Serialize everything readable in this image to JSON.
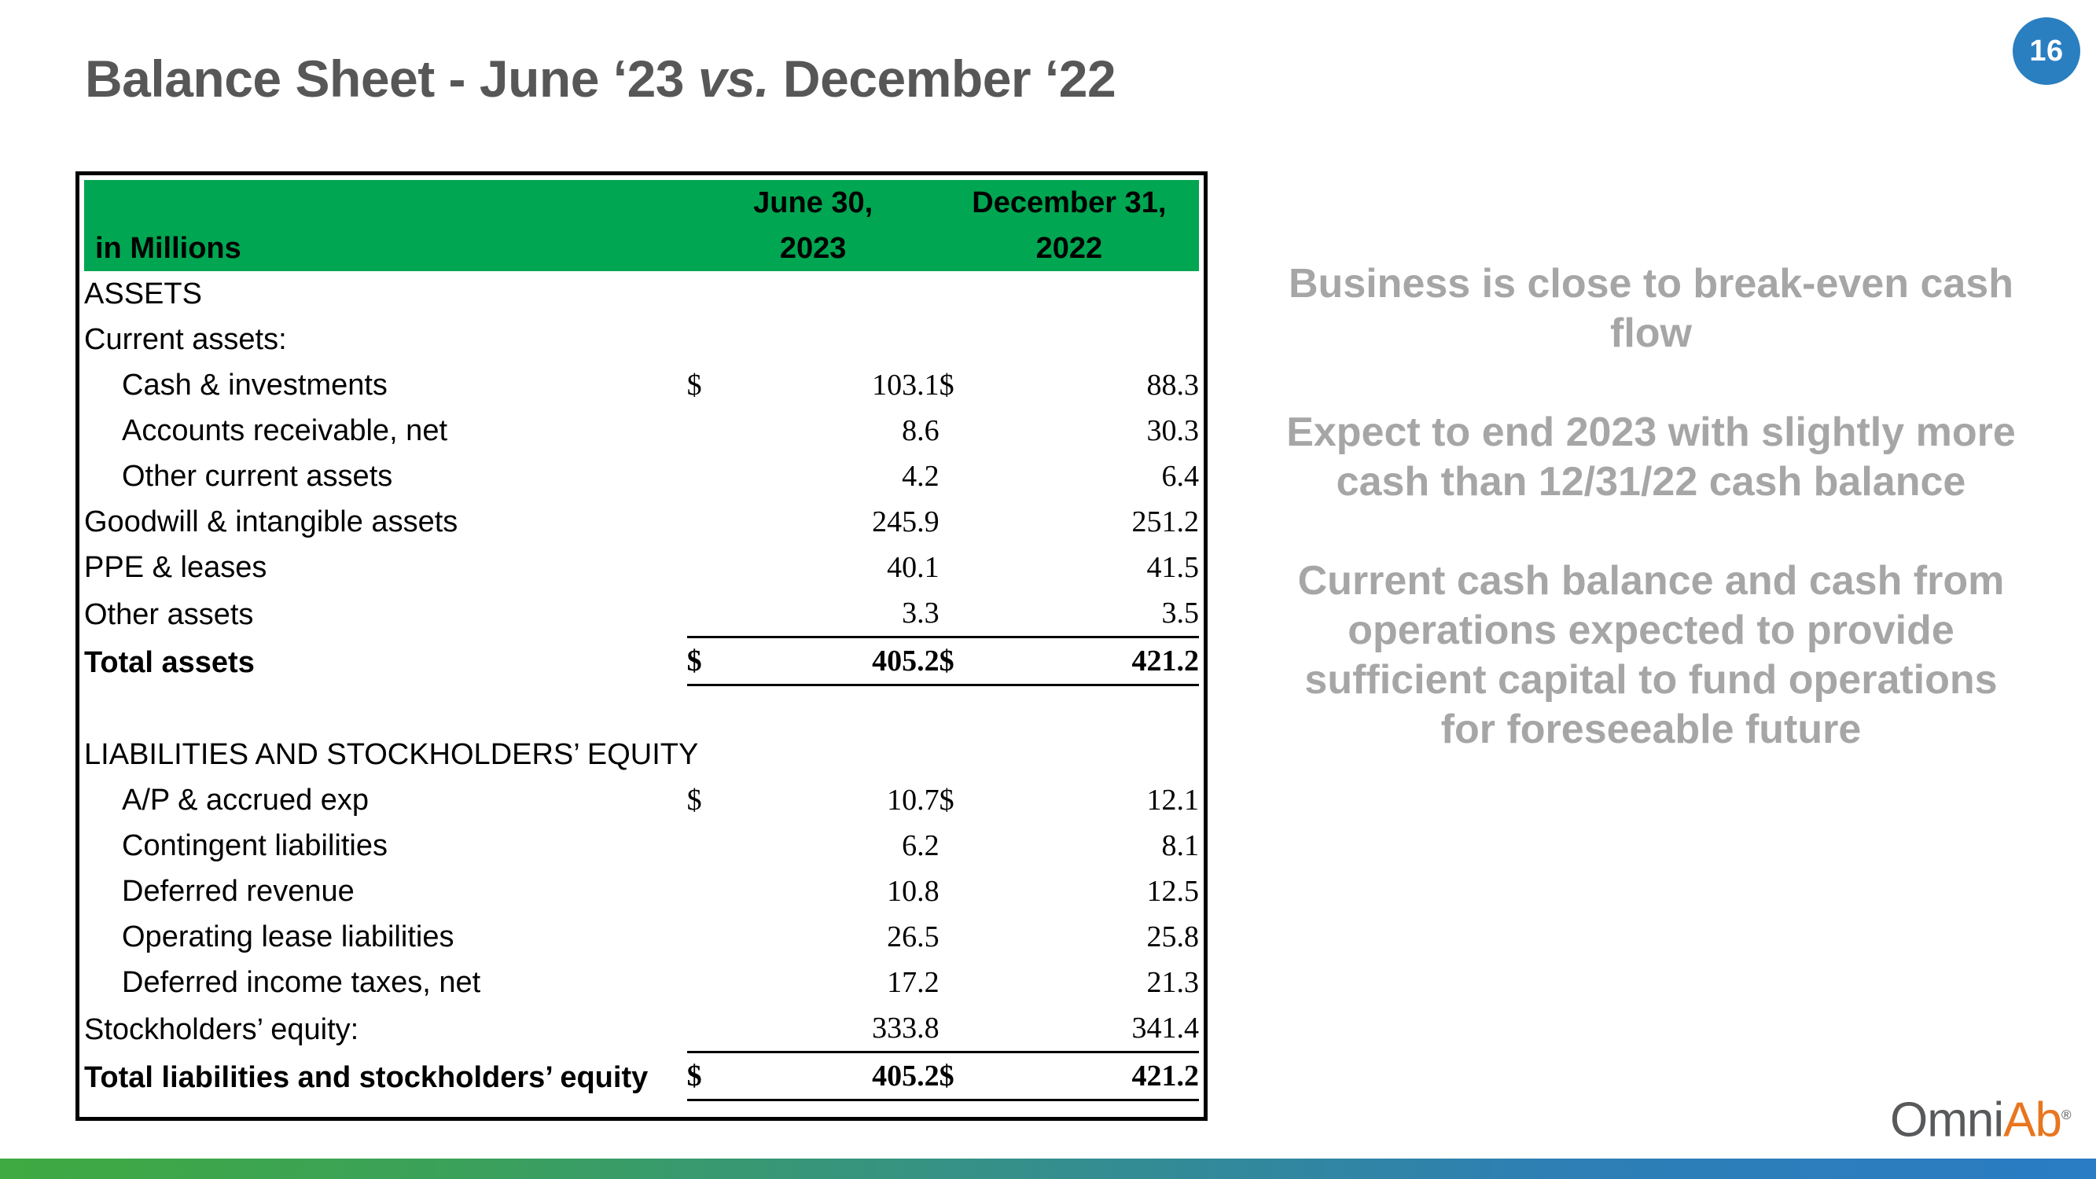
{
  "page_number": "16",
  "title": {
    "before": "Balance Sheet - June ‘23 ",
    "vs": "vs.",
    "after": " December ‘22"
  },
  "table": {
    "header": {
      "label": "in Millions",
      "col1_line1": "June 30,",
      "col1_line2": "2023",
      "col2_line1": "December 31,",
      "col2_line2": "2022"
    },
    "rows": [
      {
        "label": "ASSETS",
        "indent": false,
        "bold": false,
        "cur1": "",
        "val1": "",
        "cur2": "",
        "val2": ""
      },
      {
        "label": "Current assets:",
        "indent": false,
        "bold": false,
        "cur1": "",
        "val1": "",
        "cur2": "",
        "val2": ""
      },
      {
        "label": "Cash & investments",
        "indent": true,
        "bold": false,
        "cur1": "$",
        "val1": "103.1",
        "cur2": "$",
        "val2": "88.3"
      },
      {
        "label": "Accounts receivable, net",
        "indent": true,
        "bold": false,
        "cur1": "",
        "val1": "8.6",
        "cur2": "",
        "val2": "30.3"
      },
      {
        "label": "Other current assets",
        "indent": true,
        "bold": false,
        "cur1": "",
        "val1": "4.2",
        "cur2": "",
        "val2": "6.4"
      },
      {
        "label": "Goodwill & intangible assets",
        "indent": false,
        "bold": false,
        "cur1": "",
        "val1": "245.9",
        "cur2": "",
        "val2": "251.2"
      },
      {
        "label": "PPE & leases",
        "indent": false,
        "bold": false,
        "cur1": "",
        "val1": "40.1",
        "cur2": "",
        "val2": "41.5"
      },
      {
        "label": "Other assets",
        "indent": false,
        "bold": false,
        "cur1": "",
        "val1": "3.3",
        "cur2": "",
        "val2": "3.5"
      },
      {
        "label": "Total assets",
        "indent": false,
        "bold": true,
        "cur1": "$",
        "val1": "405.2",
        "cur2": "$",
        "val2": "421.2",
        "rule_top": true,
        "rule_bottom": true
      },
      {
        "label": "",
        "indent": false,
        "bold": false,
        "cur1": "",
        "val1": "",
        "cur2": "",
        "val2": "",
        "spacer": true
      },
      {
        "label": "LIABILITIES AND STOCKHOLDERS’ EQUITY",
        "indent": false,
        "bold": false,
        "cur1": "",
        "val1": "",
        "cur2": "",
        "val2": ""
      },
      {
        "label": "A/P & accrued exp",
        "indent": true,
        "bold": false,
        "cur1": "$",
        "val1": "10.7",
        "cur2": "$",
        "val2": "12.1"
      },
      {
        "label": "Contingent liabilities",
        "indent": true,
        "bold": false,
        "cur1": "",
        "val1": "6.2",
        "cur2": "",
        "val2": "8.1"
      },
      {
        "label": "Deferred revenue",
        "indent": true,
        "bold": false,
        "cur1": "",
        "val1": "10.8",
        "cur2": "",
        "val2": "12.5"
      },
      {
        "label": "Operating lease liabilities",
        "indent": true,
        "bold": false,
        "cur1": "",
        "val1": "26.5",
        "cur2": "",
        "val2": "25.8"
      },
      {
        "label": "Deferred income taxes, net",
        "indent": true,
        "bold": false,
        "cur1": "",
        "val1": "17.2",
        "cur2": "",
        "val2": "21.3"
      },
      {
        "label": "Stockholders’ equity:",
        "indent": false,
        "bold": false,
        "cur1": "",
        "val1": "333.8",
        "cur2": "",
        "val2": "341.4"
      },
      {
        "label": "Total liabilities and stockholders’ equity",
        "indent": false,
        "bold": true,
        "cur1": "$",
        "val1": "405.2",
        "cur2": "$",
        "val2": "421.2",
        "rule_top": true,
        "rule_bottom": true
      }
    ]
  },
  "commentary": [
    "Business is close to break-even cash flow",
    "Expect to end 2023 with slightly more cash than 12/31/22 cash balance",
    "Current cash balance and cash from operations expected to provide sufficient capital to fund operations for foreseeable future"
  ],
  "logo": {
    "omni": "Omni",
    "ab": "Ab",
    "reg": "®"
  },
  "colors": {
    "header_green": "#00a651",
    "title_gray": "#575757",
    "commentary_gray": "#a6a6a6",
    "badge_blue": "#2a7fc1",
    "logo_orange": "#e8761f",
    "footer_gradient_start": "#3faa41",
    "footer_gradient_end": "#2a7cc4"
  }
}
